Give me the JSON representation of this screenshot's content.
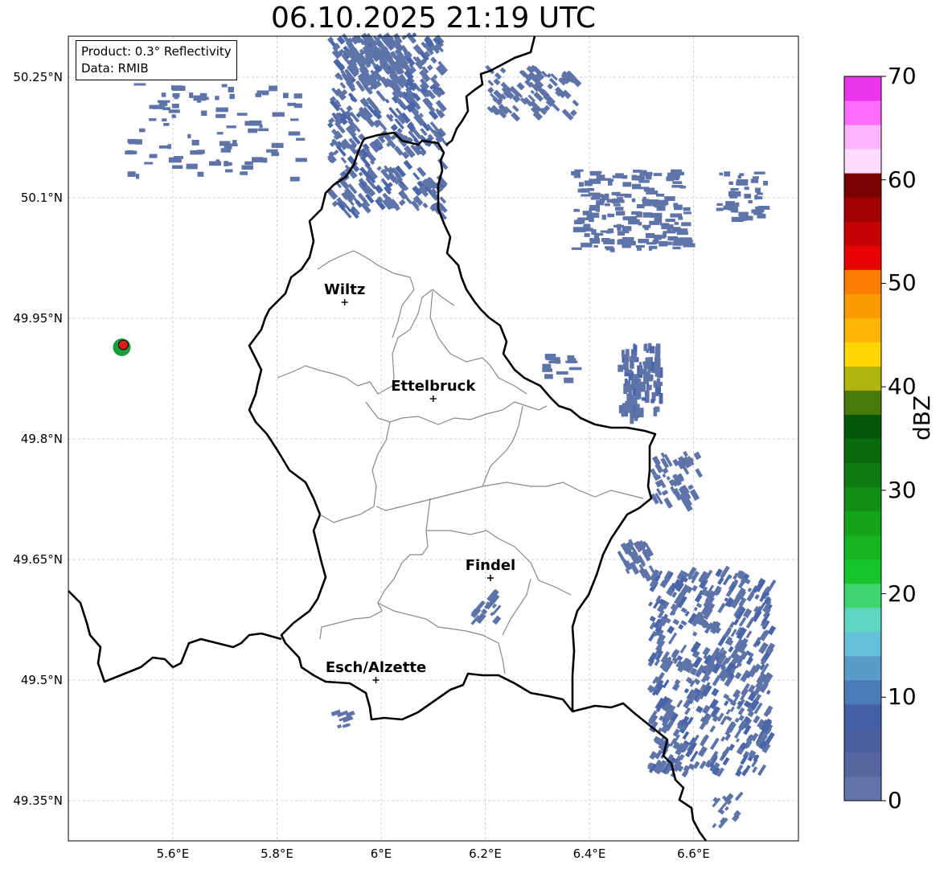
{
  "title": "06.10.2025 21:19 UTC",
  "info_box": {
    "product": "Product: 0.3° Reflectivity",
    "data": "Data: RMIB"
  },
  "axes": {
    "lon_ticks": [
      {
        "value": 5.6,
        "label": "5.6°E"
      },
      {
        "value": 5.8,
        "label": "5.8°E"
      },
      {
        "value": 6.0,
        "label": "6°E"
      },
      {
        "value": 6.2,
        "label": "6.2°E"
      },
      {
        "value": 6.4,
        "label": "6.4°E"
      },
      {
        "value": 6.6,
        "label": "6.6°E"
      }
    ],
    "lat_ticks": [
      {
        "value": 50.25,
        "label": "50.25°N"
      },
      {
        "value": 50.1,
        "label": "50.1°N"
      },
      {
        "value": 49.95,
        "label": "49.95°N"
      },
      {
        "value": 49.8,
        "label": "49.8°N"
      },
      {
        "value": 49.65,
        "label": "49.65°N"
      },
      {
        "value": 49.5,
        "label": "49.5°N"
      },
      {
        "value": 49.35,
        "label": "49.35°N"
      }
    ]
  },
  "cities": [
    {
      "name": "Wiltz",
      "lon": 5.93,
      "lat": 49.97
    },
    {
      "name": "Ettelbruck",
      "lon": 6.1,
      "lat": 49.85
    },
    {
      "name": "Findel",
      "lon": 6.21,
      "lat": 49.627
    },
    {
      "name": "Esch/Alzette",
      "lon": 5.99,
      "lat": 49.5
    }
  ],
  "radar_site": {
    "lon": 5.505,
    "lat": 49.917
  },
  "colorbar": {
    "title": "dBZ",
    "min": 0,
    "max": 70,
    "tick_labels": [
      "0",
      "10",
      "20",
      "30",
      "40",
      "50",
      "60",
      "70"
    ],
    "colors": [
      "#6273a8",
      "#56679f",
      "#4a5f9e",
      "#435fa3",
      "#4a7bb5",
      "#5a9cc8",
      "#66c0d9",
      "#5ed6c2",
      "#3ed46e",
      "#16c52a",
      "#15b520",
      "#14a41a",
      "#128e16",
      "#0e7a12",
      "#0a6a0c",
      "#065809",
      "#477a0b",
      "#b0b40e",
      "#ffd700",
      "#fcb504",
      "#fc9b04",
      "#fc7d04",
      "#e70304",
      "#c40202",
      "#a00101",
      "#780101",
      "#ffdcff",
      "#ffb4ff",
      "#ff6bff",
      "#ea35ea"
    ]
  },
  "echo_color": "#5e74a8"
}
